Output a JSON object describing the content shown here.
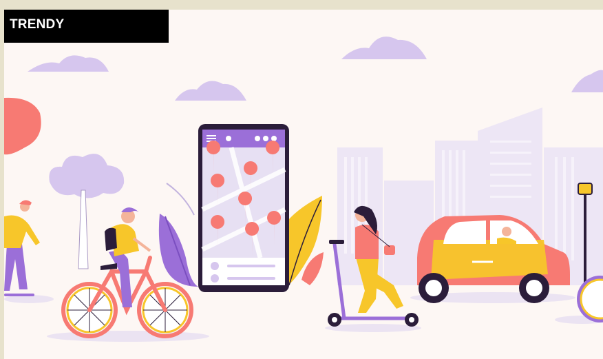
{
  "badge": {
    "label": "TRENDY"
  },
  "palette": {
    "background": "#fdf7f4",
    "cloud": "#d6c6ee",
    "building": "#ede6f5",
    "purple": "#9b6fd8",
    "coral": "#f77a73",
    "yellow": "#f7c62a",
    "dark": "#2b1d3a"
  },
  "scene": {
    "phone_map_pins": 9,
    "elements": [
      "skateboarder",
      "cyclist",
      "smartphone-map",
      "scooter-rider",
      "car",
      "street-lamp",
      "clouds",
      "city-skyline",
      "plants"
    ]
  }
}
